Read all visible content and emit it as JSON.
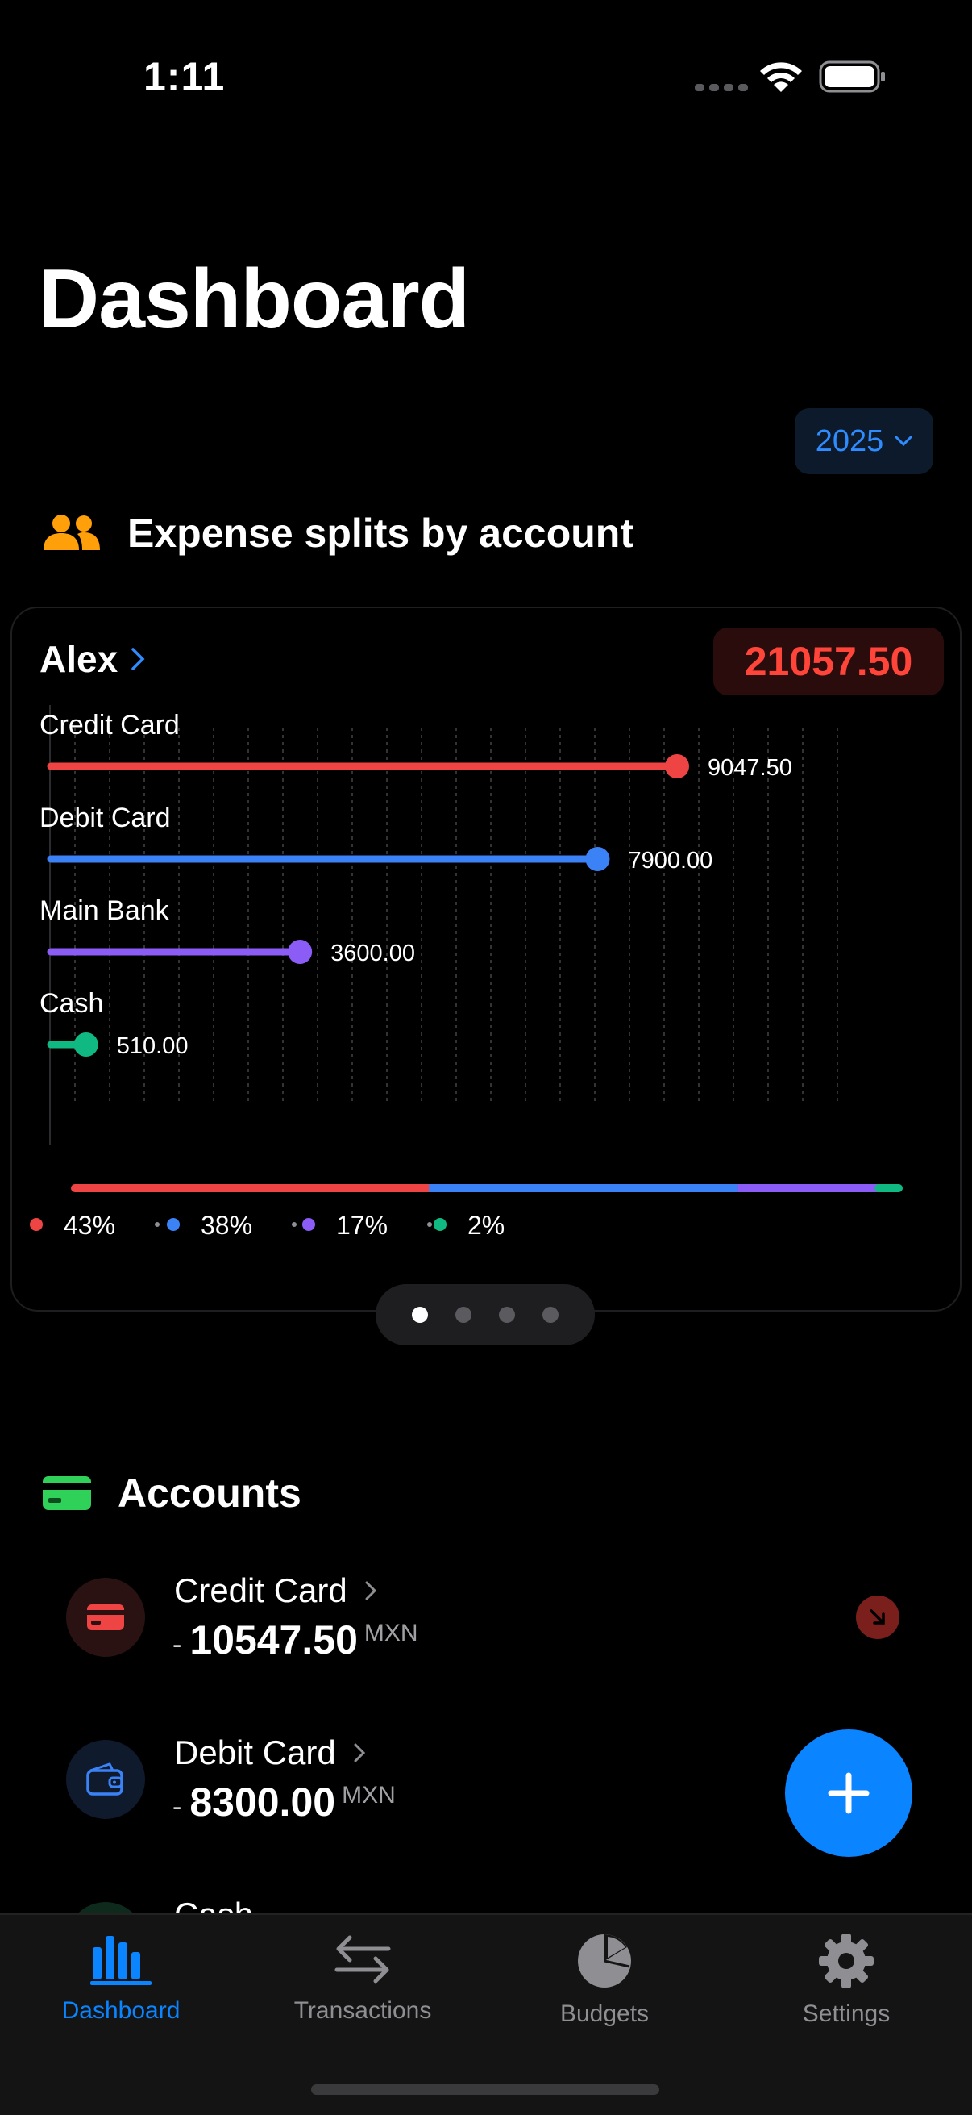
{
  "status_bar": {
    "time": "1:11"
  },
  "header": {
    "title": "Dashboard"
  },
  "year_picker": {
    "value": "2025"
  },
  "expense_section": {
    "title": "Expense splits by account",
    "owner": "Alex",
    "total": "21057.50",
    "colors": {
      "credit": "#ef4444",
      "debit": "#3b82f6",
      "bank": "#8b5cf6",
      "cash": "#10b981",
      "total_text": "#ff453a"
    }
  },
  "chart_data": {
    "type": "bar",
    "orientation": "horizontal",
    "categories": [
      "Credit Card",
      "Debit Card",
      "Main Bank",
      "Cash"
    ],
    "values": [
      9047.5,
      7900.0,
      3600.0,
      510.0
    ],
    "value_labels": [
      "9047.50",
      "7900.00",
      "3600.00",
      "510.00"
    ],
    "colors": [
      "#ef4444",
      "#3b82f6",
      "#8b5cf6",
      "#10b981"
    ],
    "grid": true,
    "share_bar": {
      "percents": [
        43,
        38,
        17,
        2
      ],
      "labels": [
        "43%",
        "38%",
        "17%",
        "2%"
      ]
    }
  },
  "pager": {
    "pages": 4,
    "active": 0
  },
  "accounts_section": {
    "title": "Accounts",
    "items": [
      {
        "name": "Credit Card",
        "sign": "-",
        "amount": "10547.50",
        "currency": "MXN"
      },
      {
        "name": "Debit Card",
        "sign": "-",
        "amount": "8300.00",
        "currency": "MXN"
      },
      {
        "name": "Cash"
      }
    ]
  },
  "tab_bar": {
    "tabs": [
      {
        "label": "Dashboard",
        "icon": "bar-chart-icon",
        "active": true
      },
      {
        "label": "Transactions",
        "icon": "arrows-icon",
        "active": false
      },
      {
        "label": "Budgets",
        "icon": "pie-chart-icon",
        "active": false
      },
      {
        "label": "Settings",
        "icon": "gear-icon",
        "active": false
      }
    ]
  }
}
